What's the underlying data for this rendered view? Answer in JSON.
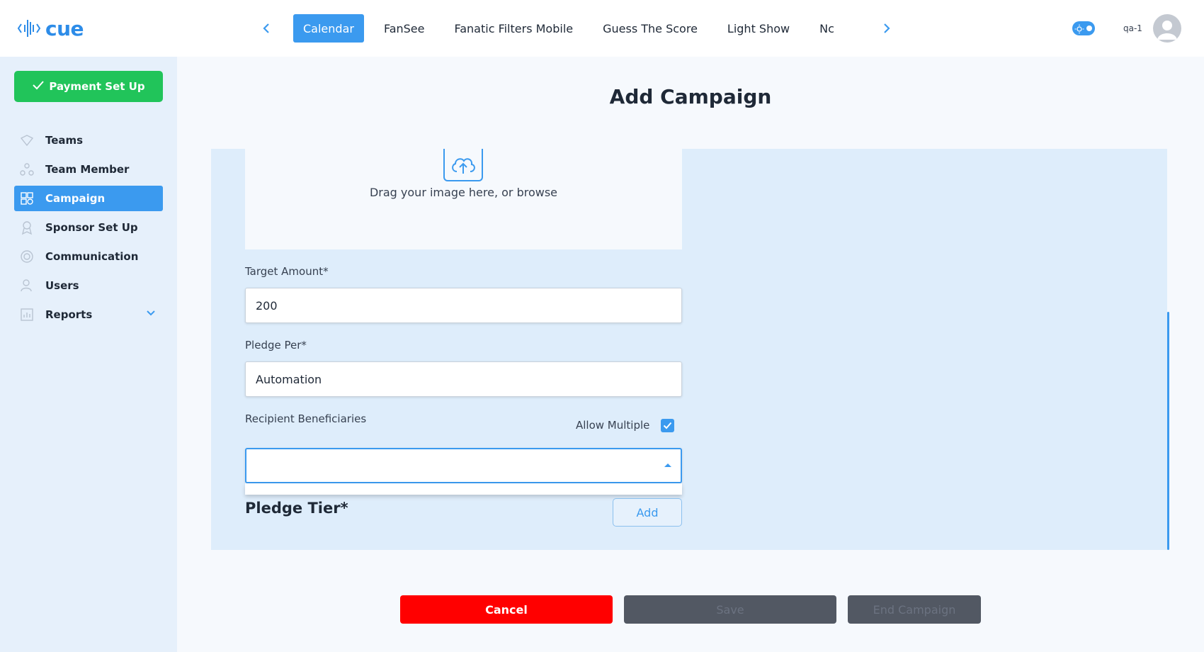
{
  "brand": {
    "name": "cue",
    "accent": "#3b9aef",
    "success": "#21c45a",
    "danger": "#ff0000"
  },
  "sidebar": {
    "payment_button": "Payment Set Up",
    "items": [
      {
        "label": "Teams",
        "icon": "teams-icon",
        "active": false
      },
      {
        "label": "Team Member",
        "icon": "team-member-icon",
        "active": false
      },
      {
        "label": "Campaign",
        "icon": "campaign-icon",
        "active": true
      },
      {
        "label": "Sponsor Set Up",
        "icon": "sponsor-icon",
        "active": false
      },
      {
        "label": "Communication",
        "icon": "communication-icon",
        "active": false
      },
      {
        "label": "Users",
        "icon": "users-icon",
        "active": false
      },
      {
        "label": "Reports",
        "icon": "reports-icon",
        "active": false,
        "expandable": true
      }
    ]
  },
  "topbar": {
    "tabs": [
      "Calendar",
      "FanSee",
      "Fanatic Filters Mobile",
      "Guess The Score",
      "Light Show",
      "Nc"
    ],
    "active_tab": "Calendar",
    "user": "qa-1"
  },
  "page": {
    "title": "Add Campaign"
  },
  "form": {
    "upload_text": "Drag your image here, or browse",
    "target_amount": {
      "label": "Target Amount*",
      "value": "200"
    },
    "pledge_per": {
      "label": "Pledge Per*",
      "value": "Automation"
    },
    "recipient": {
      "label": "Recipient Beneficiaries",
      "value": ""
    },
    "allow_multiple": {
      "label": "Allow Multiple",
      "checked": true
    },
    "pledge_tier": {
      "label": "Pledge Tier*",
      "add_button": "Add"
    }
  },
  "footer": {
    "cancel": "Cancel",
    "save": "Save",
    "end": "End Campaign"
  }
}
